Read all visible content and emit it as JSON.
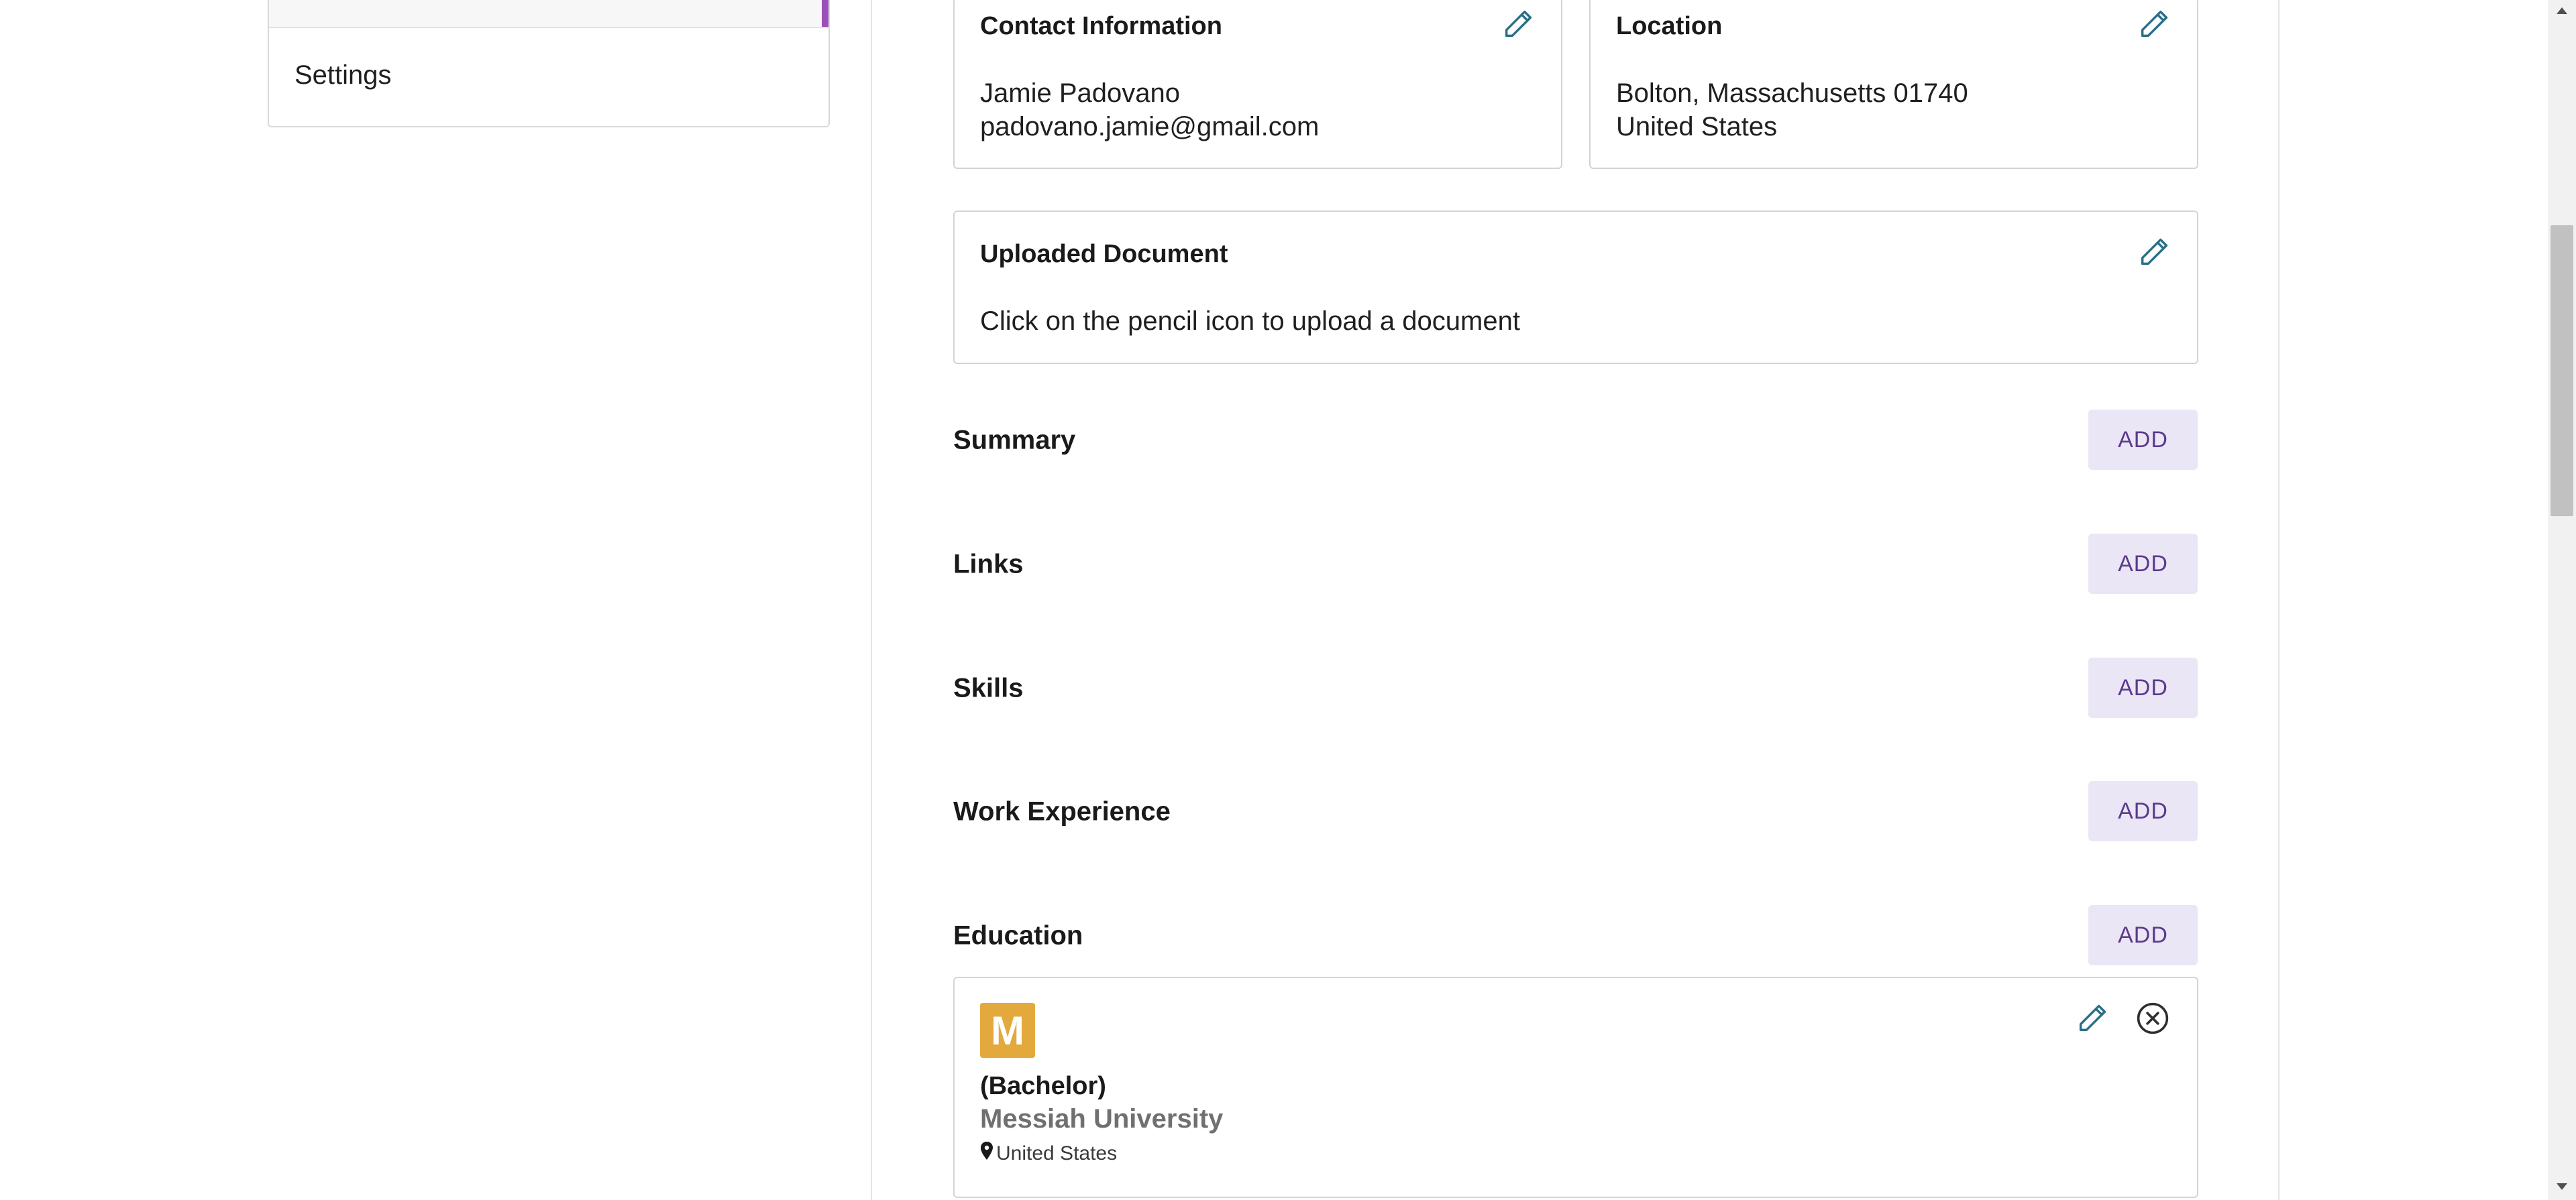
{
  "sidebar": {
    "items": [
      {
        "label": ""
      },
      {
        "label": "Settings"
      }
    ]
  },
  "contact": {
    "title": "Contact Information",
    "name": "Jamie Padovano",
    "email": "padovano.jamie@gmail.com"
  },
  "location": {
    "title": "Location",
    "line1": "Bolton, Massachusetts 01740",
    "line2": "United States"
  },
  "document": {
    "title": "Uploaded Document",
    "hint": "Click on the pencil icon to upload a document"
  },
  "sections": [
    {
      "title": "Summary",
      "action": "ADD"
    },
    {
      "title": "Links",
      "action": "ADD"
    },
    {
      "title": "Skills",
      "action": "ADD"
    },
    {
      "title": "Work Experience",
      "action": "ADD"
    },
    {
      "title": "Education",
      "action": "ADD"
    }
  ],
  "education": [
    {
      "logo_letter": "M",
      "degree": "(Bachelor)",
      "school": "Messiah University",
      "country": "United States"
    }
  ],
  "colors": {
    "accent_purple": "#5b3a8e",
    "add_button_bg": "#ebe6f5",
    "edit_icon": "#2b6f86",
    "sidebar_active_bar": "#9c4fb8",
    "logo_bg": "#e3a93c"
  },
  "icons": {
    "edit": "pencil-icon",
    "remove": "close-circle-icon",
    "location": "map-pin-icon"
  }
}
